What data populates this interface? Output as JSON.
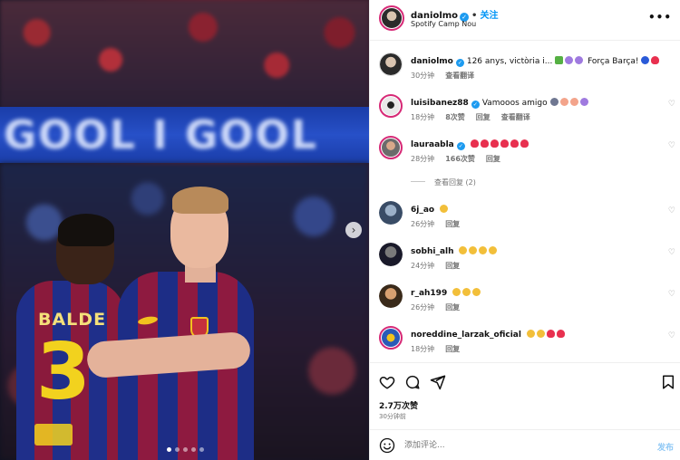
{
  "photo": {
    "banner_text": "GOOL I GOOL",
    "player_left_name": "BALDE",
    "player_left_number": "3",
    "carousel_next": "›",
    "carousel_dots": 5,
    "active_dot": 0
  },
  "header": {
    "username": "daniolmo",
    "separator": "•",
    "follow_label": "关注",
    "location": "Spotify Camp Nou",
    "more_label": "•••"
  },
  "caption": {
    "username": "daniolmo",
    "text": "126 anys, victòria i...",
    "text_end": "Força Barça!",
    "time": "30分钟",
    "translate": "查看翻译"
  },
  "comments": [
    {
      "username": "luisibanez88",
      "verified": true,
      "text": "Vamooos amigo",
      "time": "18分钟",
      "likes": "8次赞",
      "reply": "回复",
      "translate": "查看翻译"
    },
    {
      "username": "lauraabla",
      "verified": true,
      "text": "",
      "time": "28分钟",
      "likes": "166次赞",
      "reply": "回复"
    },
    {
      "username": "6j_ao",
      "verified": false,
      "text": "",
      "time": "26分钟",
      "reply": "回复"
    },
    {
      "username": "sobhi_alh",
      "verified": false,
      "text": "",
      "time": "24分钟",
      "reply": "回复"
    },
    {
      "username": "r_ah199",
      "verified": false,
      "text": "",
      "time": "26分钟",
      "reply": "回复"
    },
    {
      "username": "noreddine_larzak_oficial",
      "verified": false,
      "text": "",
      "time": "18分钟",
      "reply": "回复"
    }
  ],
  "view_replies": "查看回复 (2)",
  "actions": {
    "likes": "2.7万次赞",
    "time": "30分钟前"
  },
  "composer": {
    "placeholder": "添加评论...",
    "post_label": "发布"
  },
  "colors": {
    "accent": "#0095f6",
    "verified": "#1d9bf0",
    "story_ring": "#d62976",
    "muted": "#737373"
  }
}
